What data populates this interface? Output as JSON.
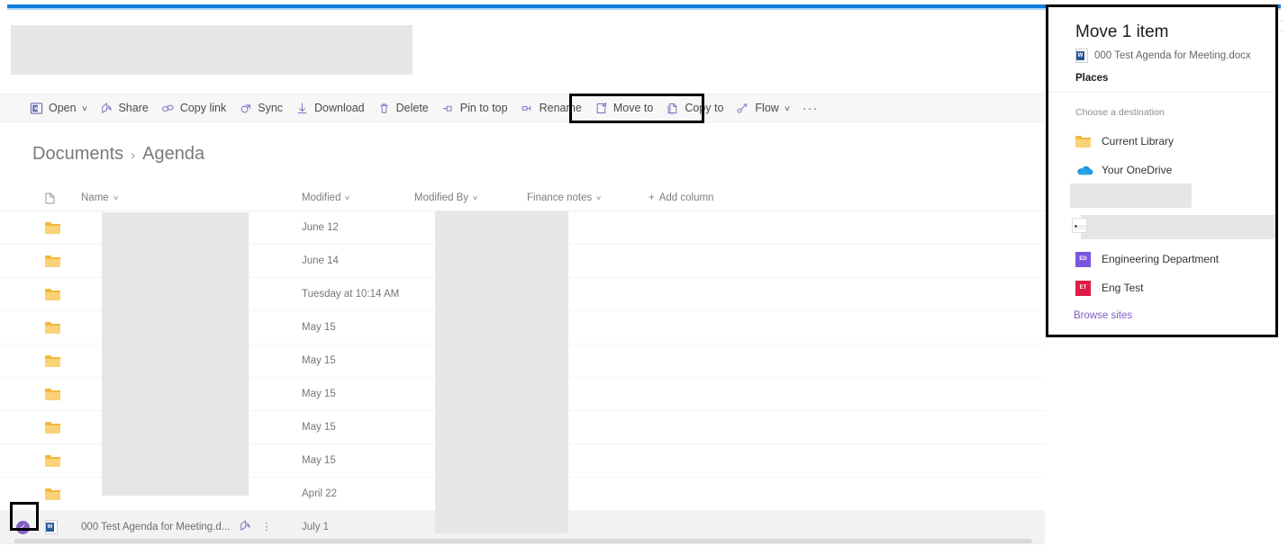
{
  "top_rule_color": "#0f7ddb",
  "accent_purple": "#8661c5",
  "commandbar": {
    "items": [
      {
        "label": "Open",
        "icon": "word-open-icon",
        "chevron": "∨"
      },
      {
        "label": "Share",
        "icon": "share-icon",
        "chevron": ""
      },
      {
        "label": "Copy link",
        "icon": "link-icon",
        "chevron": ""
      },
      {
        "label": "Sync",
        "icon": "sync-icon",
        "chevron": ""
      },
      {
        "label": "Download",
        "icon": "download-icon",
        "chevron": ""
      },
      {
        "label": "Delete",
        "icon": "trash-icon",
        "chevron": ""
      },
      {
        "label": "Pin to top",
        "icon": "pin-icon",
        "chevron": ""
      },
      {
        "label": "Rename",
        "icon": "rename-icon",
        "chevron": ""
      },
      {
        "label": "Move to",
        "icon": "move-to-icon",
        "chevron": ""
      },
      {
        "label": "Copy to",
        "icon": "copy-to-icon",
        "chevron": ""
      },
      {
        "label": "Flow",
        "icon": "flow-icon",
        "chevron": "∨"
      }
    ],
    "overflow_label": "···"
  },
  "breadcrumb": {
    "root": "Documents",
    "separator": "›",
    "current": "Agenda"
  },
  "list": {
    "columns": [
      {
        "key": "name",
        "label": "Name",
        "chevron": "∨"
      },
      {
        "key": "modified",
        "label": "Modified",
        "chevron": "∨"
      },
      {
        "key": "modified_by",
        "label": "Modified By",
        "chevron": "∨"
      },
      {
        "key": "finance_notes",
        "label": "Finance notes",
        "chevron": "∨"
      },
      {
        "key": "add_column",
        "label": "Add column",
        "prefix": "+"
      }
    ],
    "rows": [
      {
        "type": "folder",
        "name": "",
        "modified": "June 12",
        "modified_by": "",
        "finance_notes": "",
        "selected": false
      },
      {
        "type": "folder",
        "name": "",
        "modified": "June 14",
        "modified_by": "",
        "finance_notes": "",
        "selected": false
      },
      {
        "type": "folder",
        "name": "",
        "modified": "Tuesday at 10:14 AM",
        "modified_by": "",
        "finance_notes": "",
        "selected": false
      },
      {
        "type": "folder",
        "name": "",
        "modified": "May 15",
        "modified_by": "",
        "finance_notes": "",
        "selected": false
      },
      {
        "type": "folder",
        "name": "",
        "modified": "May 15",
        "modified_by": "",
        "finance_notes": "",
        "selected": false
      },
      {
        "type": "folder",
        "name": "",
        "modified": "May 15",
        "modified_by": "",
        "finance_notes": "",
        "selected": false
      },
      {
        "type": "folder",
        "name": "",
        "modified": "May 15",
        "modified_by": "",
        "finance_notes": "",
        "selected": false
      },
      {
        "type": "folder",
        "name": "",
        "modified": "May 15",
        "modified_by": "",
        "finance_notes": "",
        "selected": false
      },
      {
        "type": "folder",
        "name": "",
        "modified": "April 22",
        "modified_by": "",
        "finance_notes": "",
        "selected": false
      },
      {
        "type": "document",
        "name": "000 Test Agenda for Meeting.d...",
        "modified": "July 1",
        "modified_by": "",
        "finance_notes": "",
        "selected": true
      }
    ],
    "word_badge": "W"
  },
  "move_panel": {
    "title": "Move 1 item",
    "file_name": "000 Test Agenda for Meeting.docx",
    "places_label": "Places",
    "choose_label": "Choose a destination",
    "destinations": [
      {
        "label": "Current Library",
        "icon": "folder-icon",
        "tile_text": "",
        "tile_color": ""
      },
      {
        "label": "Your OneDrive",
        "icon": "onedrive-cloud-icon",
        "tile_text": "",
        "tile_color": ""
      },
      {
        "label": "",
        "icon": "site-thumbnail-icon",
        "tile_text": "",
        "tile_color": ""
      },
      {
        "label": "Engineering Department",
        "icon": "site-tile-icon",
        "tile_text": "ED",
        "tile_color": "#7b55e0"
      },
      {
        "label": "Eng Test",
        "icon": "site-tile-icon",
        "tile_text": "ET",
        "tile_color": "#e01b45"
      }
    ],
    "browse_sites_label": "Browse sites"
  }
}
